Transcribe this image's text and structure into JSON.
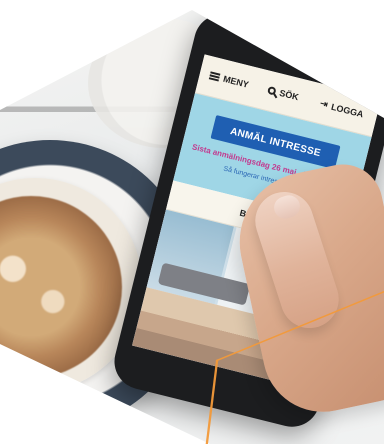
{
  "phone_ui": {
    "nav": {
      "menu_label": "MENY",
      "search_label": "SÖK",
      "login_label": "LOGGA"
    },
    "banner": {
      "button_label": "ANMÄL INTRESSE",
      "deadline_text": "Sista anmälningsdag 26 maj - 5 dagar kvar",
      "subtext": "Så fungerar intresseanmälan"
    },
    "gallery": {
      "label": "BILDER"
    }
  },
  "colors": {
    "banner_bg": "#9fd6e6",
    "cta_bg": "#1f5fb2",
    "deadline_text": "#c23a8e",
    "accent_outline": "#f39a3a"
  }
}
